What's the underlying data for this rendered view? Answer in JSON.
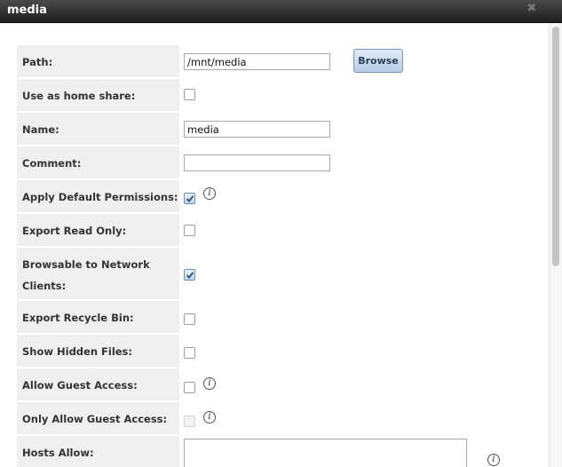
{
  "dialog": {
    "title": "media",
    "close_glyph": "✖"
  },
  "fields": {
    "path": {
      "label": "Path:",
      "value": "/mnt/media",
      "button": "Browse"
    },
    "home_share": {
      "label": "Use as home share:",
      "checked": false
    },
    "name": {
      "label": "Name:",
      "value": "media"
    },
    "comment": {
      "label": "Comment:",
      "value": ""
    },
    "default_permissions": {
      "label": "Apply Default Permissions:",
      "checked": true
    },
    "read_only": {
      "label": "Export Read Only:",
      "checked": false
    },
    "browsable": {
      "label_line1": "Browsable to Network",
      "label_line2": "Clients:",
      "checked": true
    },
    "recycle_bin": {
      "label": "Export Recycle Bin:",
      "checked": false
    },
    "hidden_files": {
      "label": "Show Hidden Files:",
      "checked": false
    },
    "guest_access": {
      "label": "Allow Guest Access:",
      "checked": false
    },
    "guest_only": {
      "label": "Only Allow Guest Access:",
      "checked": false,
      "disabled": true
    },
    "hosts_allow": {
      "label": "Hosts Allow:",
      "value": ""
    }
  },
  "icons": {
    "info": "i"
  }
}
